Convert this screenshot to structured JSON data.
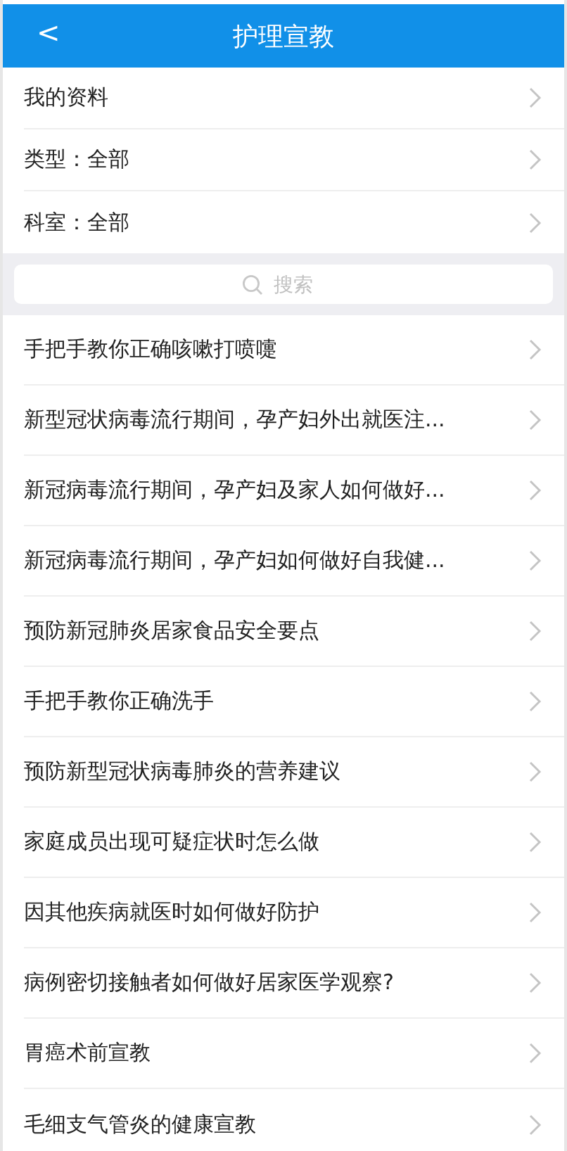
{
  "header": {
    "back": "<",
    "title": "护理宣教"
  },
  "filters": [
    {
      "label": "我的资料"
    },
    {
      "label": "类型：全部"
    },
    {
      "label": "科室：全部"
    }
  ],
  "search": {
    "placeholder": "搜索"
  },
  "articles": [
    {
      "title": "手把手教你正确咳嗽打喷嚏"
    },
    {
      "title": "新型冠状病毒流行期间，孕产妇外出就医注..."
    },
    {
      "title": "新冠病毒流行期间，孕产妇及家人如何做好..."
    },
    {
      "title": "新冠病毒流行期间，孕产妇如何做好自我健..."
    },
    {
      "title": "预防新冠肺炎居家食品安全要点"
    },
    {
      "title": "手把手教你正确洗手"
    },
    {
      "title": "预防新型冠状病毒肺炎的营养建议"
    },
    {
      "title": "家庭成员出现可疑症状时怎么做"
    },
    {
      "title": "因其他疾病就医时如何做好防护"
    },
    {
      "title": "病例密切接触者如何做好居家医学观察?"
    },
    {
      "title": "胃癌术前宣教"
    },
    {
      "title": "毛细支气管炎的健康宣教"
    }
  ]
}
